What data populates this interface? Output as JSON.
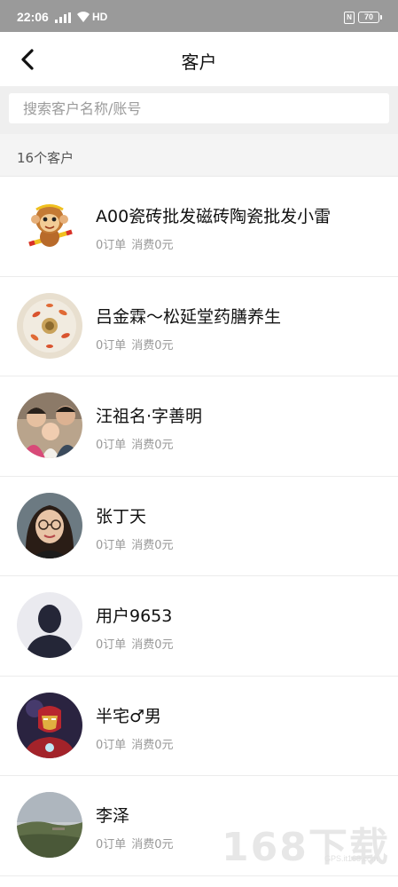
{
  "status_bar": {
    "time": "22:06",
    "network": "HD",
    "nfc_label": "N",
    "battery": "70",
    "icons": [
      "signal-icon",
      "wifi-icon",
      "nfc-icon",
      "battery-icon"
    ]
  },
  "header": {
    "back_icon": "chevron-left-icon",
    "title": "客户"
  },
  "search": {
    "placeholder": "搜索客户名称/账号",
    "value": ""
  },
  "summary": {
    "count_text": "16个客户"
  },
  "customers": [
    {
      "name": "A00瓷砖批发磁砖陶瓷批发小雷",
      "orders": "0订单",
      "spent": "消费0元",
      "avatar": "monkey-cartoon-avatar"
    },
    {
      "name": "吕金霖～松延堂药膳养生",
      "orders": "0订单",
      "spent": "消费0元",
      "avatar": "koi-plate-avatar"
    },
    {
      "name": "汪祖名·字善明",
      "orders": "0订单",
      "spent": "消费0元",
      "avatar": "family-photo-avatar"
    },
    {
      "name": "张丁天",
      "orders": "0订单",
      "spent": "消费0元",
      "avatar": "woman-portrait-avatar"
    },
    {
      "name": "用户9653",
      "orders": "0订单",
      "spent": "消费0元",
      "avatar": "default-user-avatar"
    },
    {
      "name": "半宅♂男",
      "orders": "0订单",
      "spent": "消费0元",
      "avatar": "ironman-avatar"
    },
    {
      "name": "李泽",
      "orders": "0订单",
      "spent": "消费0元",
      "avatar": "landscape-avatar"
    }
  ],
  "watermark": {
    "logo_text": "168下载",
    "sub_text": "GPS.it168.com"
  },
  "colors": {
    "status_bar": "#9a9a9a",
    "page_bg": "#ffffff",
    "section_bg": "#f4f4f4",
    "secondary_text": "#999999"
  }
}
